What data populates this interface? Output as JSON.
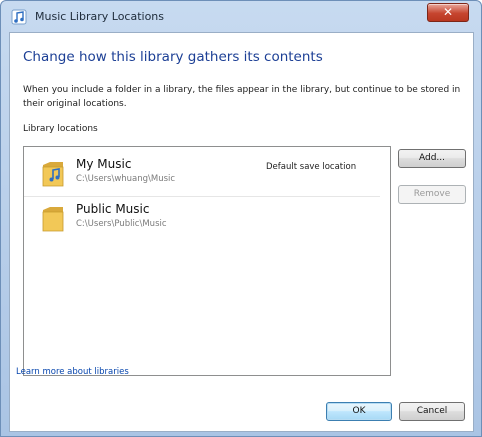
{
  "window": {
    "title": "Music Library Locations",
    "close_glyph": "✕",
    "icon": "music-note-icon",
    "colors": {
      "heading": "#1c3f95",
      "link": "#0645ad",
      "close": "#c6452f"
    }
  },
  "content": {
    "heading": "Change how this library gathers its contents",
    "description": "When you include a folder in a library, the files appear in the library, but continue to be stored in their original locations.",
    "section_label": "Library locations",
    "locations": [
      {
        "name": "My Music",
        "path": "C:\\Users\\whuang\\Music",
        "tag": "Default save location",
        "icon": "music-folder-icon"
      },
      {
        "name": "Public Music",
        "path": "C:\\Users\\Public\\Music",
        "icon": "folder-icon"
      }
    ],
    "add_label": "Add...",
    "remove_label": "Remove",
    "learn_more": "Learn more about libraries"
  },
  "footer": {
    "ok_label": "OK",
    "cancel_label": "Cancel"
  }
}
